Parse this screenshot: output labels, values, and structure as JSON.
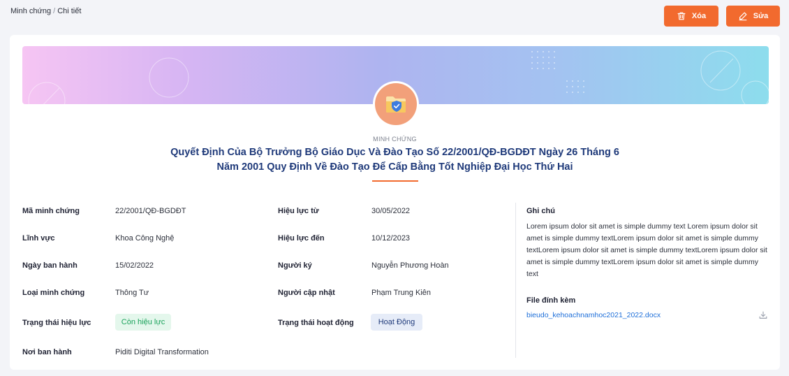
{
  "breadcrumb": {
    "parent": "Minh chứng",
    "separator": "/",
    "current": "Chi tiết"
  },
  "actions": {
    "delete_label": "Xóa",
    "edit_label": "Sửa"
  },
  "header": {
    "overline": "MINH CHỨNG",
    "title": "Quyết Định Của Bộ Trưởng Bộ Giáo Dục Và Đào Tạo Số 22/2001/QĐ-BGDĐT Ngày 26 Tháng 6 Năm 2001 Quy Định Về Đào Tạo Để Cấp Bằng Tốt Nghiệp Đại Học Thứ Hai",
    "avatar_icon": "folder-shield-icon"
  },
  "left_fields": {
    "code": {
      "label": "Mã minh chứng",
      "value": "22/2001/QĐ-BGDĐT"
    },
    "field": {
      "label": "Lĩnh vực",
      "value": "Khoa Công Nghệ"
    },
    "issue_date": {
      "label": "Ngày ban hành",
      "value": "15/02/2022"
    },
    "type": {
      "label": "Loại minh chứng",
      "value": "Thông Tư"
    },
    "validity_status": {
      "label": "Trạng thái hiệu lực",
      "value": "Còn hiệu lực"
    },
    "issuer": {
      "label": "Nơi ban hành",
      "value": "Piditi Digital Transformation"
    }
  },
  "middle_fields": {
    "valid_from": {
      "label": "Hiệu lực từ",
      "value": "30/05/2022"
    },
    "valid_to": {
      "label": "Hiệu lực đến",
      "value": "10/12/2023"
    },
    "signer": {
      "label": "Người ký",
      "value": "Nguyễn Phương Hoàn"
    },
    "updater": {
      "label": "Người cập nhật",
      "value": "Phạm Trung Kiên"
    },
    "activity_status": {
      "label": "Trạng thái hoạt động",
      "value": "Hoạt Động"
    }
  },
  "notes": {
    "label": "Ghi chú",
    "body": "Lorem ipsum dolor sit amet is simple dummy text Lorem ipsum dolor sit amet is simple dummy textLorem ipsum dolor sit amet is simple dummy textLorem ipsum dolor sit amet is simple dummy textLorem ipsum dolor sit amet is simple dummy textLorem ipsum dolor sit amet is simple dummy text"
  },
  "attachment": {
    "label": "File đính kèm",
    "filename": "bieudo_kehoachnamhoc2021_2022.docx"
  },
  "colors": {
    "accent": "#f26a2e",
    "title_blue": "#1f3a7a",
    "status_green": "#1aa25b",
    "link_blue": "#1e6fd9"
  }
}
